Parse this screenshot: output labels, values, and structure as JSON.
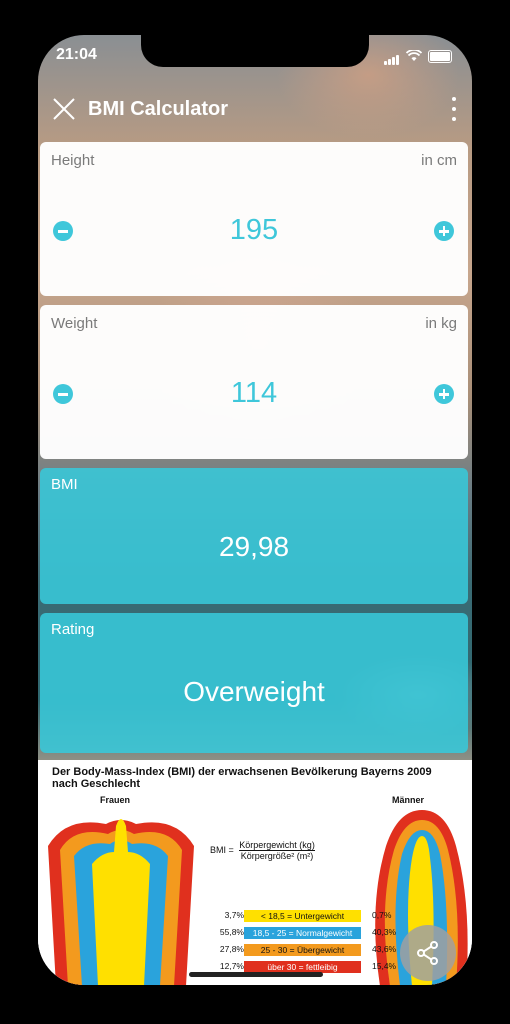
{
  "status": {
    "time": "21:04"
  },
  "app": {
    "title": "BMI Calculator"
  },
  "height": {
    "label": "Height",
    "unit": "in cm",
    "value": "195"
  },
  "weight": {
    "label": "Weight",
    "unit": "in kg",
    "value": "114"
  },
  "bmi": {
    "label": "BMI",
    "value": "29,98"
  },
  "rating": {
    "label": "Rating",
    "value": "Overweight"
  },
  "infographic": {
    "title": "Der Body-Mass-Index (BMI) der erwachsenen Bevölkerung Bayerns 2009 nach Geschlecht",
    "women_label": "Frauen",
    "men_label": "Männer",
    "formula_lhs": "BMI =",
    "formula_num": "Körpergewicht (kg)",
    "formula_den": "Körpergröße² (m²)",
    "rows": [
      {
        "women": "3,7%",
        "band": "< 18,5 = Untergewicht",
        "men": "0,7%"
      },
      {
        "women": "55,8%",
        "band": "18,5 - 25 = Normalgewicht",
        "men": "40,3%"
      },
      {
        "women": "27,8%",
        "band": "25 - 30 = Übergewicht",
        "men": "43,6%"
      },
      {
        "women": "12,7%",
        "band": "über 30 = fettleibig",
        "men": "15,4%"
      }
    ]
  },
  "colors": {
    "accent": "#3fc7da",
    "band_under": "#ffe000",
    "band_normal": "#2aa3dc",
    "band_over": "#f39a1e",
    "band_obese": "#e0301e"
  }
}
